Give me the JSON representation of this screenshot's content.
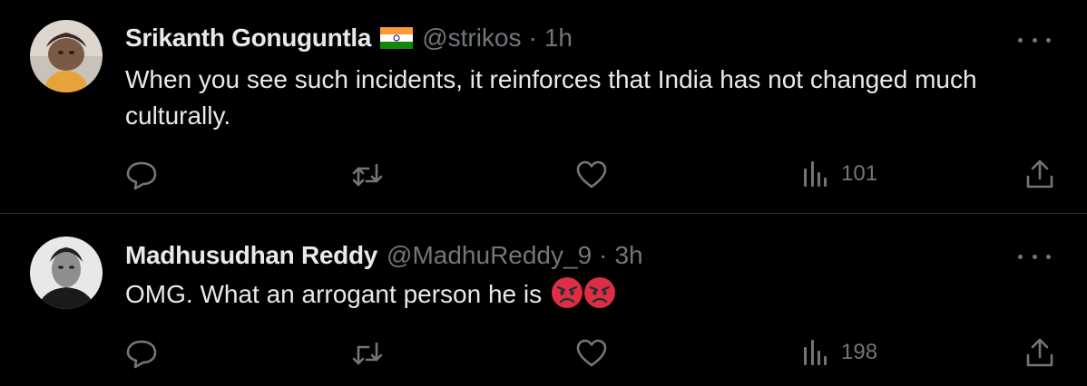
{
  "tweets": [
    {
      "name": "Srikanth Gonuguntla",
      "handle": "@strikos",
      "separator": "·",
      "time": "1h",
      "text": "When you see such incidents, it reinforces that India has not changed much culturally.",
      "views": "101",
      "flag_icon": "india-flag-icon"
    },
    {
      "name": "Madhusudhan Reddy",
      "handle": "@MadhuReddy_9",
      "separator": "·",
      "time": "3h",
      "text": "OMG. What an arrogant person he is",
      "emoji_icons": [
        "angry-face-emoji-icon",
        "angry-face-emoji-icon"
      ],
      "views": "198"
    }
  ],
  "colors": {
    "background": "#000000",
    "primary_text": "#e7e9ea",
    "secondary_text": "#71767b",
    "divider": "#2f3336"
  }
}
